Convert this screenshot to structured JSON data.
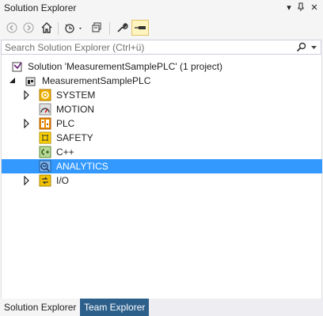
{
  "window": {
    "title": "Solution Explorer",
    "pin_glyph": "▾",
    "close_glyph": "✕"
  },
  "toolbar": {
    "buttons": [
      "back-icon",
      "forward-icon",
      "home-icon",
      "history-icon",
      "switch-views-icon",
      "properties-wrench-icon",
      "preview-pin-icon"
    ]
  },
  "search": {
    "placeholder": "Search Solution Explorer (Ctrl+ü)"
  },
  "tree": {
    "solution": "Solution 'MeasurementSamplePLC' (1 project)",
    "project": "MeasurementSamplePLC",
    "items": [
      {
        "label": "SYSTEM",
        "icon": "system-icon",
        "expandable": true
      },
      {
        "label": "MOTION",
        "icon": "motion-icon",
        "expandable": false
      },
      {
        "label": "PLC",
        "icon": "plc-icon",
        "expandable": true
      },
      {
        "label": "SAFETY",
        "icon": "safety-icon",
        "expandable": false
      },
      {
        "label": "C++",
        "icon": "cpp-icon",
        "expandable": false
      },
      {
        "label": "ANALYTICS",
        "icon": "analytics-icon",
        "expandable": false,
        "selected": true
      },
      {
        "label": "I/O",
        "icon": "io-icon",
        "expandable": true
      }
    ]
  },
  "tabs": {
    "active": "Solution Explorer",
    "inactive": "Team Explorer"
  },
  "colors": {
    "selection": "#3399ff",
    "tab_inactive": "#2d5f8b",
    "active_tool": "#fdf4bf"
  }
}
